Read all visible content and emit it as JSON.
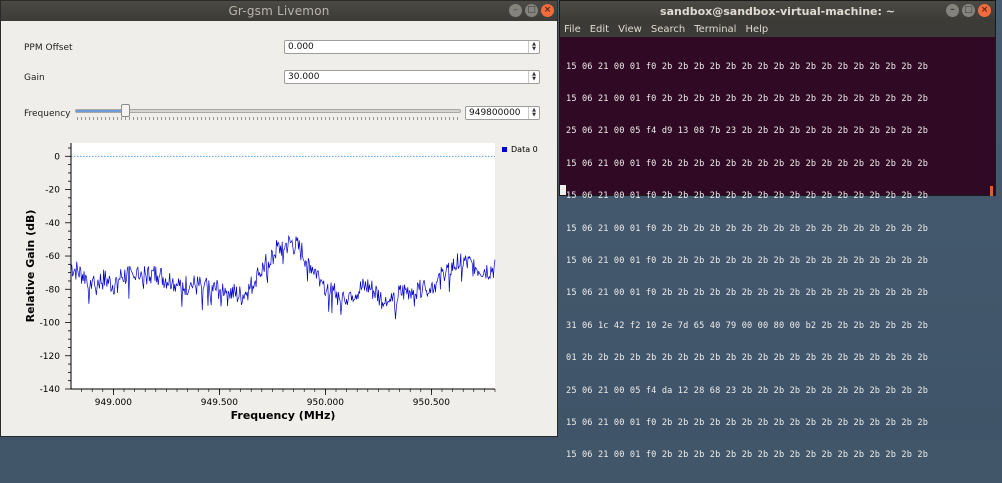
{
  "livemon": {
    "title": "Gr-gsm Livemon",
    "ppm_label": "PPM Offset",
    "ppm_value": "0.000",
    "gain_label": "Gain",
    "gain_value": "30.000",
    "freq_label": "Frequency",
    "freq_value": "949800000",
    "freq_slider_fraction": 0.13
  },
  "chart_data": {
    "type": "line",
    "xlabel": "Frequency (MHz)",
    "ylabel": "Relative Gain (dB)",
    "xlim": [
      948.8,
      950.8
    ],
    "ylim": [
      -140,
      8
    ],
    "xticks": [
      949.0,
      949.5,
      950.0,
      950.5
    ],
    "xtick_labels": [
      "949.000",
      "949.500",
      "950.000",
      "950.500"
    ],
    "yticks": [
      0,
      -20,
      -40,
      -60,
      -80,
      -100,
      -120,
      -140
    ],
    "ytick_labels": [
      "0",
      "-20",
      "-40",
      "-60",
      "-80",
      "-100",
      "-120",
      "-140"
    ],
    "reference_line": 0,
    "legend": "top-right",
    "series": [
      {
        "name": "Data 0",
        "color": "#0000cc",
        "x": [
          948.8,
          948.84,
          948.88,
          948.92,
          948.96,
          949.0,
          949.04,
          949.08,
          949.12,
          949.16,
          949.2,
          949.24,
          949.28,
          949.32,
          949.36,
          949.4,
          949.44,
          949.48,
          949.52,
          949.56,
          949.6,
          949.64,
          949.68,
          949.72,
          949.76,
          949.8,
          949.84,
          949.88,
          949.92,
          949.96,
          950.0,
          950.04,
          950.08,
          950.12,
          950.16,
          950.2,
          950.24,
          950.28,
          950.32,
          950.36,
          950.4,
          950.44,
          950.48,
          950.52,
          950.56,
          950.6,
          950.64,
          950.68,
          950.72,
          950.76,
          950.8
        ],
        "y": [
          -66,
          -70,
          -73,
          -75,
          -74,
          -77,
          -72,
          -71,
          -70,
          -72,
          -71,
          -73,
          -75,
          -78,
          -77,
          -78,
          -79,
          -80,
          -79,
          -82,
          -84,
          -80,
          -72,
          -64,
          -57,
          -54,
          -52,
          -56,
          -63,
          -70,
          -78,
          -82,
          -85,
          -82,
          -80,
          -78,
          -82,
          -88,
          -86,
          -82,
          -80,
          -79,
          -80,
          -76,
          -70,
          -66,
          -63,
          -65,
          -67,
          -68,
          -67
        ]
      }
    ]
  },
  "terminal": {
    "title": "sandbox@sandbox-virtual-machine: ~",
    "menu": [
      "File",
      "Edit",
      "View",
      "Search",
      "Terminal",
      "Help"
    ],
    "lines": [
      "15 06 21 00 01 f0 2b 2b 2b 2b 2b 2b 2b 2b 2b 2b 2b 2b 2b 2b 2b 2b 2b",
      "15 06 21 00 01 f0 2b 2b 2b 2b 2b 2b 2b 2b 2b 2b 2b 2b 2b 2b 2b 2b 2b",
      "25 06 21 00 05 f4 d9 13 08 7b 23 2b 2b 2b 2b 2b 2b 2b 2b 2b 2b 2b 2b",
      "15 06 21 00 01 f0 2b 2b 2b 2b 2b 2b 2b 2b 2b 2b 2b 2b 2b 2b 2b 2b 2b",
      "15 06 21 00 01 f0 2b 2b 2b 2b 2b 2b 2b 2b 2b 2b 2b 2b 2b 2b 2b 2b 2b",
      "15 06 21 00 01 f0 2b 2b 2b 2b 2b 2b 2b 2b 2b 2b 2b 2b 2b 2b 2b 2b 2b",
      "15 06 21 00 01 f0 2b 2b 2b 2b 2b 2b 2b 2b 2b 2b 2b 2b 2b 2b 2b 2b 2b",
      "15 06 21 00 01 f0 2b 2b 2b 2b 2b 2b 2b 2b 2b 2b 2b 2b 2b 2b 2b 2b 2b",
      "31 06 1c 42 f2 10 2e 7d 65 40 79 00 00 80 00 b2 2b 2b 2b 2b 2b 2b 2b",
      "01 2b 2b 2b 2b 2b 2b 2b 2b 2b 2b 2b 2b 2b 2b 2b 2b 2b 2b 2b 2b 2b 2b",
      "25 06 21 00 05 f4 da 12 28 68 23 2b 2b 2b 2b 2b 2b 2b 2b 2b 2b 2b 2b",
      "15 06 21 00 01 f0 2b 2b 2b 2b 2b 2b 2b 2b 2b 2b 2b 2b 2b 2b 2b 2b 2b",
      "15 06 21 00 01 f0 2b 2b 2b 2b 2b 2b 2b 2b 2b 2b 2b 2b 2b 2b 2b 2b 2b"
    ]
  }
}
